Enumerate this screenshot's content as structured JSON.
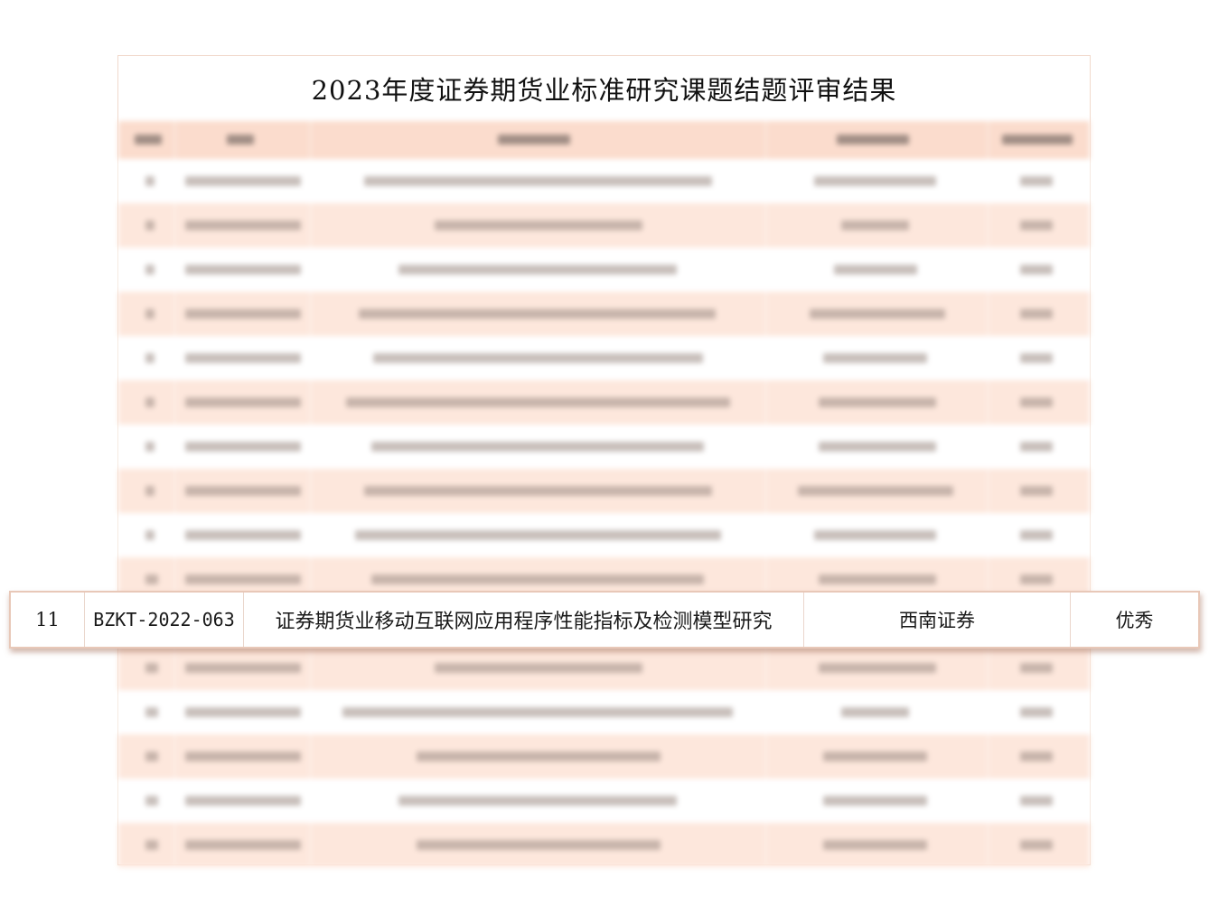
{
  "document": {
    "title": "2023年度证券期货业标准研究课题结题评审结果"
  },
  "highlighted_row": {
    "no": "11",
    "id": "BZKT-2022-063",
    "title": "证券期货业移动互联网应用程序性能指标及检测模型研究",
    "unit": "西南证券",
    "result": "优秀"
  },
  "colors": {
    "row_tint": "#fde7dc",
    "header_tint": "#fbdccd",
    "border": "#e8c8b8"
  }
}
